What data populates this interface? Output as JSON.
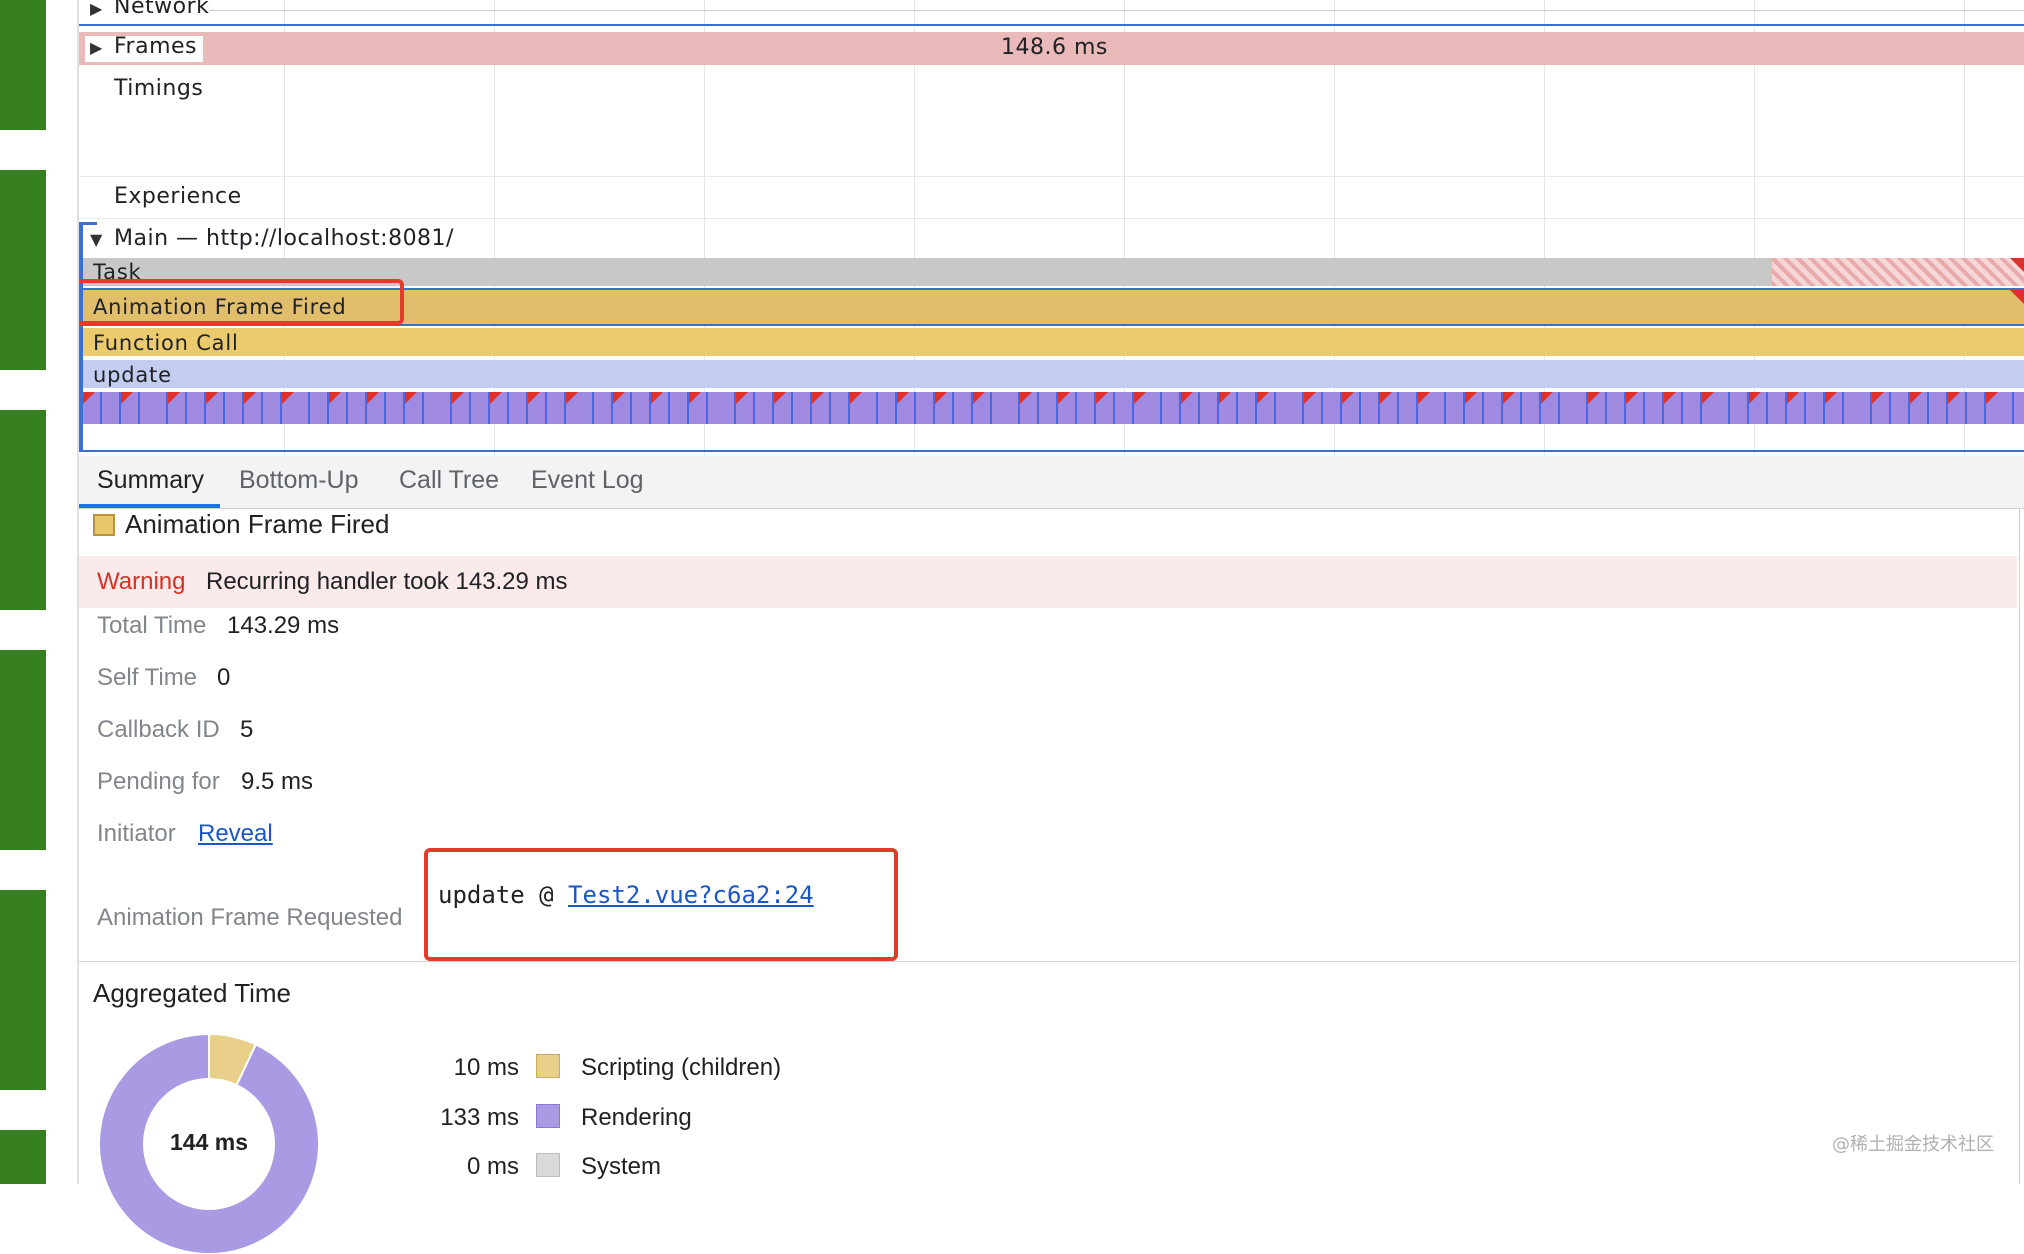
{
  "timeline": {
    "tracks": {
      "network": "Network",
      "frames": "Frames",
      "frames_time": "148.6 ms",
      "timings": "Timings",
      "experience": "Experience",
      "main": "Main — http://localhost:8081/"
    },
    "flame": {
      "task": "Task",
      "animation_frame_fired": "Animation Frame Fired",
      "function_call": "Function Call",
      "update": "update"
    },
    "colors": {
      "task": "#c8c8c8",
      "animation_frame_fired": "#e0be6c",
      "function_call": "#eccb6e",
      "update": "#c3cdf0",
      "rendering": "#a089e0",
      "frames": "#eab9b9"
    }
  },
  "tabs": [
    {
      "label": "Summary",
      "active": true
    },
    {
      "label": "Bottom-Up",
      "active": false
    },
    {
      "label": "Call Tree",
      "active": false
    },
    {
      "label": "Event Log",
      "active": false
    }
  ],
  "summary": {
    "title": "Animation Frame Fired",
    "warning_label": "Warning",
    "warning_text": "Recurring handler took 143.29 ms",
    "rows": [
      {
        "label": "Total Time",
        "value": "143.29 ms"
      },
      {
        "label": "Self Time",
        "value": "0"
      },
      {
        "label": "Callback ID",
        "value": "5"
      },
      {
        "label": "Pending for",
        "value": "9.5 ms"
      }
    ],
    "initiator_label": "Initiator",
    "initiator_link": "Reveal",
    "requested_label": "Animation Frame Requested",
    "requested_fn": "update @ ",
    "requested_link": "Test2.vue?c6a2:24"
  },
  "aggregated": {
    "title": "Aggregated Time",
    "total": "144 ms",
    "items": [
      {
        "time": "10 ms",
        "name": "Scripting (children)",
        "color": "#e8d08a",
        "ms": 10
      },
      {
        "time": "133 ms",
        "name": "Rendering",
        "color": "#a99ae3",
        "ms": 133
      },
      {
        "time": "0 ms",
        "name": "System",
        "color": "#dadada",
        "ms": 0
      }
    ]
  },
  "watermark": "@稀土掘金技术社区"
}
